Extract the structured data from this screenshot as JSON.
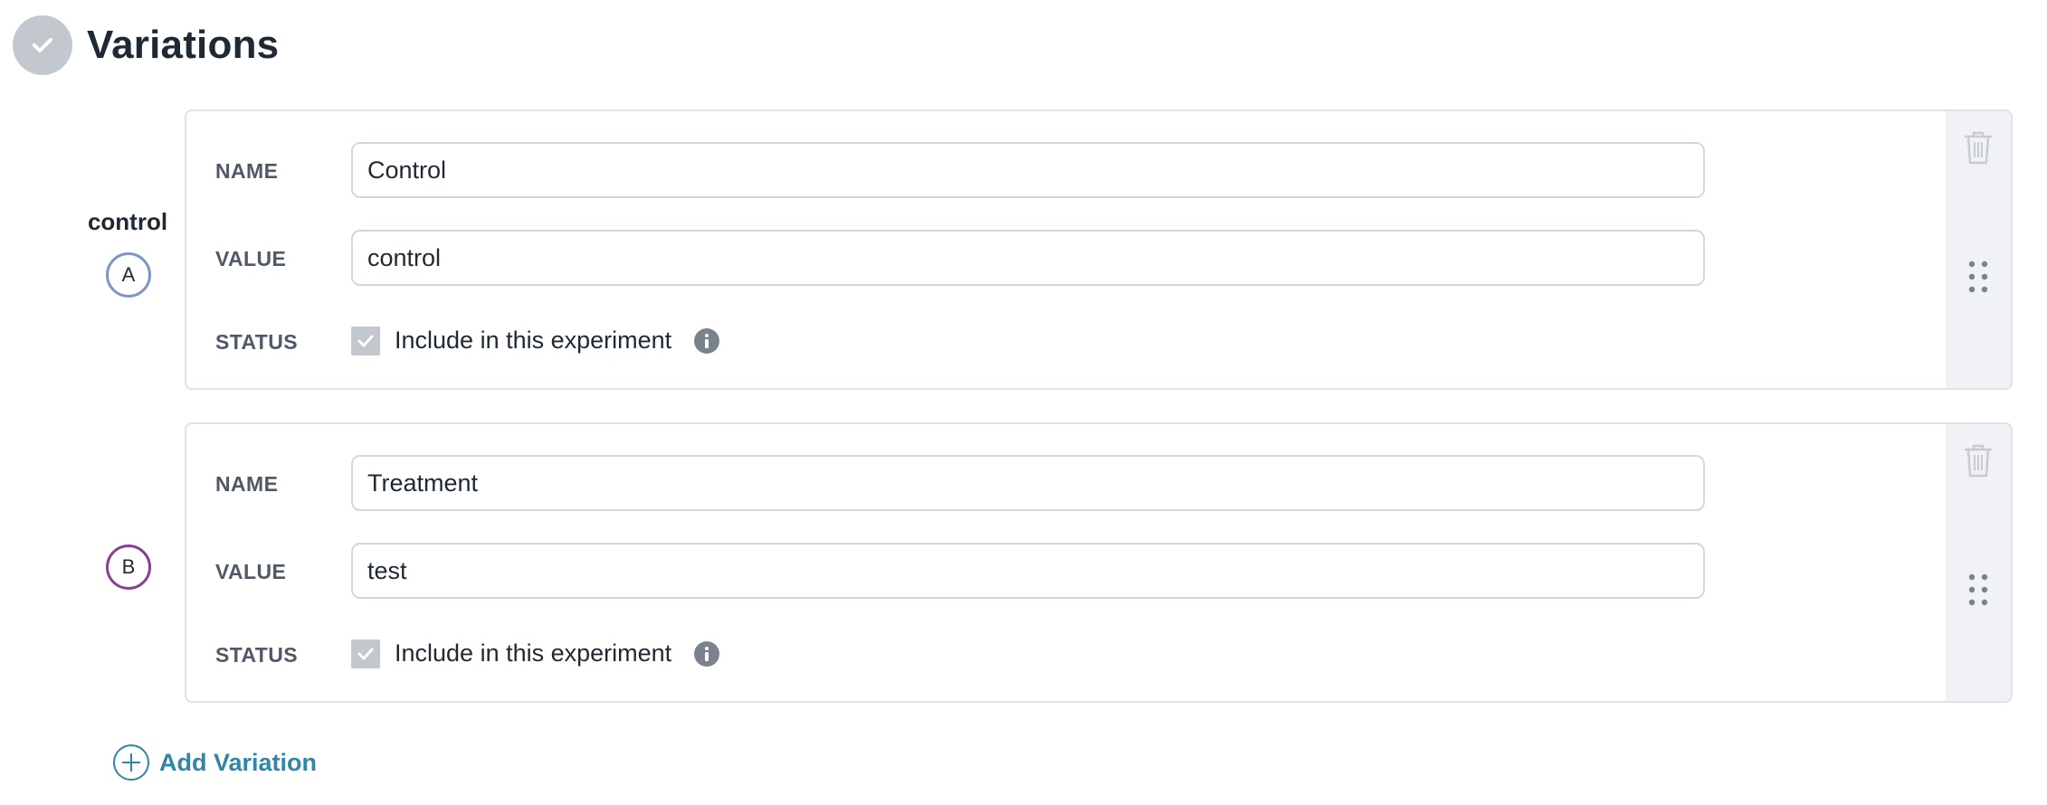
{
  "section": {
    "title": "Variations",
    "check_icon": "check-icon"
  },
  "labels": {
    "name": "NAME",
    "value": "VALUE",
    "status": "STATUS",
    "include": "Include in this experiment"
  },
  "variations": [
    {
      "key": "control",
      "letter": "A",
      "letter_color": "#7d97c4",
      "name": "Control",
      "value": "control",
      "included": true
    },
    {
      "key": "",
      "letter": "B",
      "letter_color": "#8a3f8f",
      "name": "Treatment",
      "value": "test",
      "included": true
    }
  ],
  "actions": {
    "add_variation": "Add Variation",
    "trash_icon": "trash-icon",
    "drag_icon": "drag-handle-icon",
    "info_icon": "info-icon",
    "add_icon": "plus-circle-icon"
  },
  "colors": {
    "accent": "#2f86a6",
    "muted": "#c3c8cf",
    "border": "#dfe2e6",
    "side_panel": "#f0f2f5"
  }
}
